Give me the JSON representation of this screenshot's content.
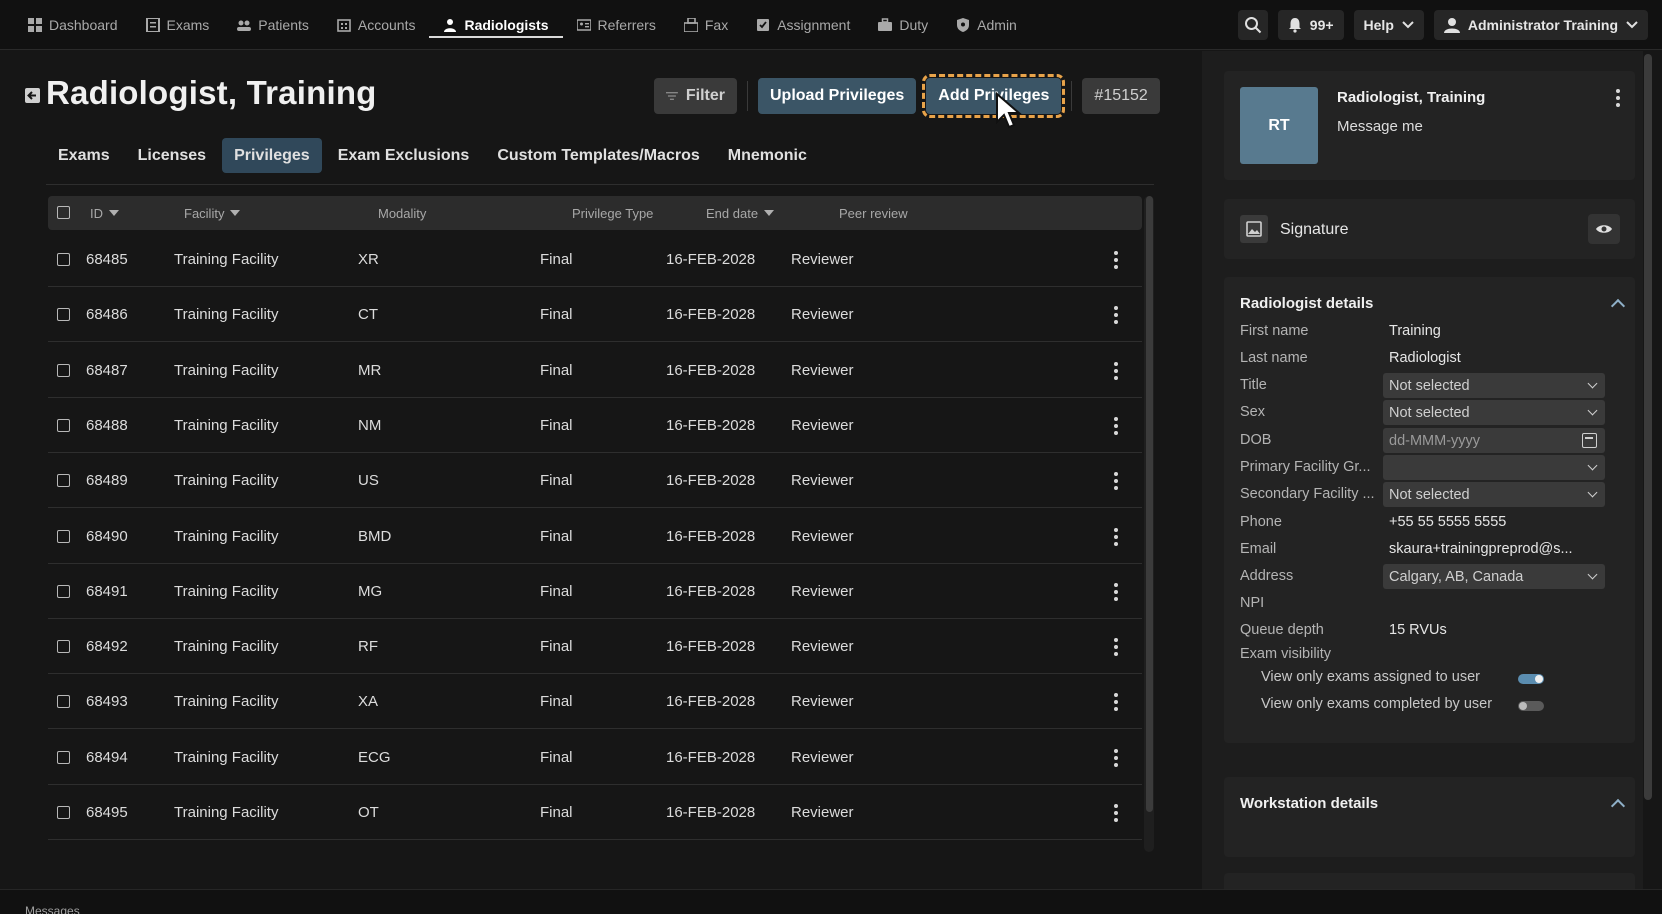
{
  "nav": {
    "items": [
      {
        "label": "Dashboard",
        "icon": "dashboard-icon"
      },
      {
        "label": "Exams",
        "icon": "exams-icon"
      },
      {
        "label": "Patients",
        "icon": "patients-icon"
      },
      {
        "label": "Accounts",
        "icon": "accounts-icon"
      },
      {
        "label": "Radiologists",
        "icon": "radiologist-icon",
        "active": true
      },
      {
        "label": "Referrers",
        "icon": "referrers-icon"
      },
      {
        "label": "Fax",
        "icon": "fax-icon"
      },
      {
        "label": "Assignment",
        "icon": "assignment-icon"
      },
      {
        "label": "Duty",
        "icon": "duty-icon"
      },
      {
        "label": "Admin",
        "icon": "admin-shield-icon"
      }
    ],
    "notifications": "99+",
    "help": "Help",
    "user": "Administrator Training"
  },
  "page": {
    "title": "Radiologist, Training",
    "filter_label": "Filter",
    "upload_label": "Upload Privileges",
    "add_label": "Add Privileges",
    "record_id": "#15152"
  },
  "tabs": [
    {
      "label": "Exams"
    },
    {
      "label": "Licenses"
    },
    {
      "label": "Privileges",
      "active": true
    },
    {
      "label": "Exam Exclusions"
    },
    {
      "label": "Custom Templates/Macros"
    },
    {
      "label": "Mnemonic"
    }
  ],
  "table": {
    "columns": [
      "ID",
      "Facility",
      "Modality",
      "Privilege Type",
      "End date",
      "Peer review"
    ],
    "rows": [
      {
        "id": "68485",
        "facility": "Training Facility",
        "modality": "XR",
        "type": "Final",
        "end": "16-FEB-2028",
        "peer": "Reviewer"
      },
      {
        "id": "68486",
        "facility": "Training Facility",
        "modality": "CT",
        "type": "Final",
        "end": "16-FEB-2028",
        "peer": "Reviewer"
      },
      {
        "id": "68487",
        "facility": "Training Facility",
        "modality": "MR",
        "type": "Final",
        "end": "16-FEB-2028",
        "peer": "Reviewer"
      },
      {
        "id": "68488",
        "facility": "Training Facility",
        "modality": "NM",
        "type": "Final",
        "end": "16-FEB-2028",
        "peer": "Reviewer"
      },
      {
        "id": "68489",
        "facility": "Training Facility",
        "modality": "US",
        "type": "Final",
        "end": "16-FEB-2028",
        "peer": "Reviewer"
      },
      {
        "id": "68490",
        "facility": "Training Facility",
        "modality": "BMD",
        "type": "Final",
        "end": "16-FEB-2028",
        "peer": "Reviewer"
      },
      {
        "id": "68491",
        "facility": "Training Facility",
        "modality": "MG",
        "type": "Final",
        "end": "16-FEB-2028",
        "peer": "Reviewer"
      },
      {
        "id": "68492",
        "facility": "Training Facility",
        "modality": "RF",
        "type": "Final",
        "end": "16-FEB-2028",
        "peer": "Reviewer"
      },
      {
        "id": "68493",
        "facility": "Training Facility",
        "modality": "XA",
        "type": "Final",
        "end": "16-FEB-2028",
        "peer": "Reviewer"
      },
      {
        "id": "68494",
        "facility": "Training Facility",
        "modality": "ECG",
        "type": "Final",
        "end": "16-FEB-2028",
        "peer": "Reviewer"
      },
      {
        "id": "68495",
        "facility": "Training Facility",
        "modality": "OT",
        "type": "Final",
        "end": "16-FEB-2028",
        "peer": "Reviewer"
      }
    ]
  },
  "profile": {
    "initials": "RT",
    "name": "Radiologist, Training",
    "message": "Message me"
  },
  "signature": {
    "label": "Signature"
  },
  "details": {
    "title": "Radiologist details",
    "first_name_label": "First name",
    "first_name": "Training",
    "last_name_label": "Last name",
    "last_name": "Radiologist",
    "title_label": "Title",
    "title_value": "Not selected",
    "sex_label": "Sex",
    "sex_value": "Not selected",
    "dob_label": "DOB",
    "dob_placeholder": "dd-MMM-yyyy",
    "primary_label": "Primary Facility Gr...",
    "primary_value": "",
    "secondary_label": "Secondary Facility ...",
    "secondary_value": "Not selected",
    "phone_label": "Phone",
    "phone": "+55 55 5555 5555",
    "email_label": "Email",
    "email": "skaura+trainingpreprod@s...",
    "address_label": "Address",
    "address": "Calgary, AB, Canada",
    "npi_label": "NPI",
    "npi": "",
    "queue_label": "Queue depth",
    "queue": "15 RVUs",
    "visibility_label": "Exam visibility",
    "toggle1_label": "View only exams assigned to user",
    "toggle1_on": true,
    "toggle2_label": "View only exams completed by user",
    "toggle2_on": false
  },
  "workstation": {
    "title": "Workstation details"
  },
  "footer": {
    "messages": "Messages"
  },
  "colors": {
    "accent": "#3b5566",
    "active_tab": "#30485a",
    "focus_outline": "#e8a34a",
    "toggle_on": "#5b8db0"
  }
}
